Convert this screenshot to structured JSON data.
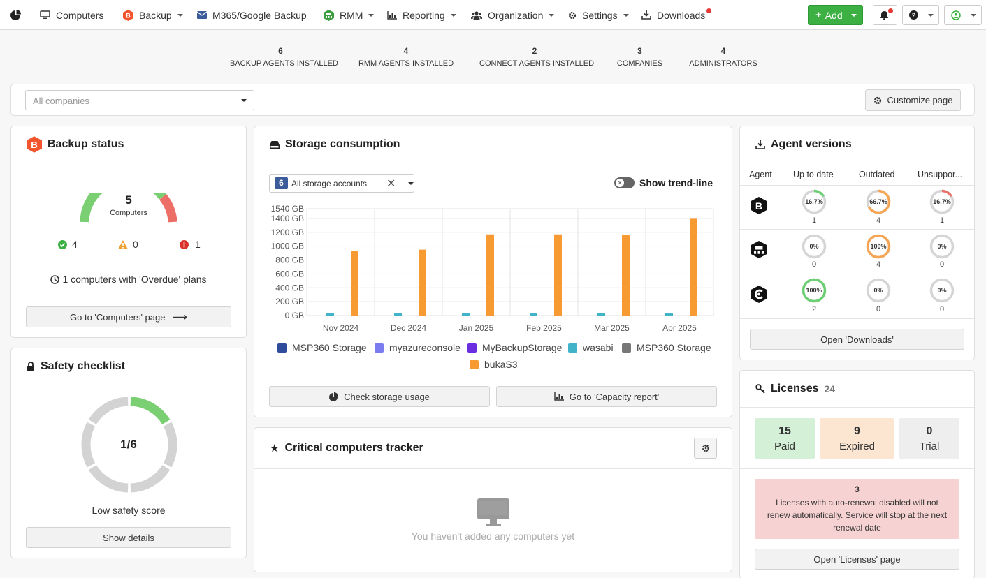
{
  "nav": {
    "items": [
      {
        "label": "Computers",
        "icon": "monitor-icon"
      },
      {
        "label": "Backup",
        "icon": "backup-logo-icon"
      },
      {
        "label": "M365/Google Backup",
        "icon": "envelope-icon"
      },
      {
        "label": "RMM",
        "icon": "rmm-logo-icon"
      },
      {
        "label": "Reporting",
        "icon": "bar-chart-icon"
      },
      {
        "label": "Organization",
        "icon": "users-icon"
      },
      {
        "label": "Settings",
        "icon": "gear-icon"
      },
      {
        "label": "Downloads",
        "icon": "download-icon"
      }
    ],
    "add_label": "Add",
    "colors": {
      "accent_green": "#3cb043",
      "notify_red": "#e53935"
    }
  },
  "stats": [
    {
      "value": "6",
      "label": "BACKUP AGENTS INSTALLED"
    },
    {
      "value": "4",
      "label": "RMM AGENTS INSTALLED"
    },
    {
      "value": "2",
      "label": "CONNECT AGENTS INSTALLED"
    },
    {
      "value": "3",
      "label": "COMPANIES"
    },
    {
      "value": "4",
      "label": "ADMINISTRATORS"
    }
  ],
  "filter": {
    "company_placeholder": "All companies",
    "customize_label": "Customize page"
  },
  "backup_status": {
    "title": "Backup status",
    "total": "5",
    "total_label": "Computers",
    "ok": "4",
    "warning": "0",
    "error": "1",
    "overdue_text": "1 computers with 'Overdue' plans",
    "goto_label": "Go to 'Computers' page"
  },
  "safety": {
    "title": "Safety checklist",
    "score": "1/6",
    "score_fraction": 0.1667,
    "score_text": "Low safety score",
    "details_label": "Show details"
  },
  "storage": {
    "title": "Storage consumption",
    "accounts_count": "6",
    "accounts_label": "All storage accounts",
    "trend_label": "Show trend-line",
    "check_label": "Check storage usage",
    "capacity_label": "Go to 'Capacity report'"
  },
  "chart_data": {
    "type": "bar",
    "categories": [
      "Nov 2024",
      "Dec 2024",
      "Jan 2025",
      "Feb 2025",
      "Mar 2025",
      "Apr 2025"
    ],
    "ylim": [
      0,
      1540
    ],
    "yticks": [
      0,
      200,
      400,
      600,
      800,
      1000,
      1200,
      1400,
      1540
    ],
    "yunit": "GB",
    "grid": true,
    "legend_position": "bottom",
    "series": [
      {
        "name": "MSP360 Storage",
        "color": "#2f4b9b",
        "values": [
          0,
          0,
          0,
          0,
          0,
          0
        ]
      },
      {
        "name": "myazureconsole",
        "color": "#7b7cf0",
        "values": [
          0,
          0,
          0,
          0,
          0,
          0
        ]
      },
      {
        "name": "MyBackupStorage",
        "color": "#6a2ee0",
        "values": [
          0,
          0,
          0,
          0,
          0,
          0
        ]
      },
      {
        "name": "wasabi",
        "color": "#41b3c9",
        "values": [
          30,
          30,
          30,
          30,
          30,
          30
        ]
      },
      {
        "name": "MSP360 Storage",
        "color": "#777777",
        "values": [
          0,
          0,
          0,
          0,
          0,
          0
        ]
      },
      {
        "name": "bukaS3",
        "color": "#f79a32",
        "values": [
          930,
          950,
          1170,
          1170,
          1160,
          1395
        ]
      }
    ]
  },
  "tracker": {
    "title": "Critical computers tracker",
    "empty_text": "You haven't added any computers yet"
  },
  "agents": {
    "title": "Agent versions",
    "headers": [
      "Agent",
      "Up to date",
      "Outdated",
      "Unsuppor..."
    ],
    "rows": [
      {
        "icon": "backup-agent-icon",
        "cells": [
          {
            "pct": "16.7%",
            "frac": 0.167,
            "count": "1"
          },
          {
            "pct": "66.7%",
            "frac": 0.667,
            "count": "4"
          },
          {
            "pct": "16.7%",
            "frac": 0.167,
            "count": "1"
          }
        ]
      },
      {
        "icon": "rmm-agent-icon",
        "cells": [
          {
            "pct": "0%",
            "frac": 0,
            "count": "0"
          },
          {
            "pct": "100%",
            "frac": 1,
            "count": "4"
          },
          {
            "pct": "0%",
            "frac": 0,
            "count": "0"
          }
        ]
      },
      {
        "icon": "connect-agent-icon",
        "cells": [
          {
            "pct": "100%",
            "frac": 1,
            "count": "2"
          },
          {
            "pct": "0%",
            "frac": 0,
            "count": "0"
          },
          {
            "pct": "0%",
            "frac": 0,
            "count": "0"
          }
        ]
      }
    ],
    "ring_colors": [
      "#6ccf73",
      "#f5a553",
      "#e8716a"
    ],
    "downloads_label": "Open 'Downloads'"
  },
  "licenses": {
    "title": "Licenses",
    "total": "24",
    "paid": "15",
    "paid_label": "Paid",
    "expired": "9",
    "expired_label": "Expired",
    "trial": "0",
    "trial_label": "Trial",
    "warning_count": "3",
    "warning_text": "Licenses with auto-renewal disabled will not renew automatically. Service will stop at the next renewal date",
    "open_label": "Open 'Licenses' page"
  }
}
